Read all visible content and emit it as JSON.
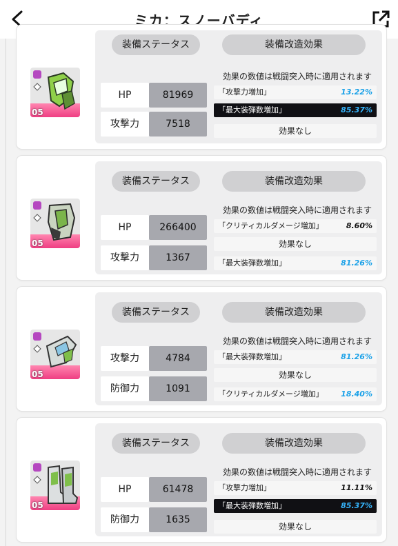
{
  "header": {
    "title": "ミカ：スノーバディ"
  },
  "labels": {
    "status": "装備ステータス",
    "modify": "装備改造効果",
    "note": "効果の数値は戦闘突入時に適用されます"
  },
  "colors": {
    "accent_blue": "#1aa1e8",
    "pink": "#ef3e82"
  },
  "cards": [
    {
      "grade": "05",
      "icon": "gloves-icon",
      "stats": [
        {
          "label": "HP",
          "value": "81969"
        },
        {
          "label": "攻撃力",
          "value": "7518"
        }
      ],
      "effects": [
        {
          "name": "「攻撃力増加」",
          "value": "13.22%",
          "style": "normal"
        },
        {
          "name": "「最大装弾数増加」",
          "value": "85.37%",
          "style": "dark"
        },
        {
          "name": "効果なし",
          "value": "",
          "style": "none"
        }
      ]
    },
    {
      "grade": "05",
      "icon": "armor-icon",
      "stats": [
        {
          "label": "HP",
          "value": "266400"
        },
        {
          "label": "攻撃力",
          "value": "1367"
        }
      ],
      "effects": [
        {
          "name": "「クリティカルダメージ増加」",
          "value": "8.60%",
          "style": "normal-black"
        },
        {
          "name": "効果なし",
          "value": "",
          "style": "none"
        },
        {
          "name": "「最大装弾数増加」",
          "value": "81.26%",
          "style": "normal"
        }
      ]
    },
    {
      "grade": "05",
      "icon": "gauntlet-icon",
      "stats": [
        {
          "label": "攻撃力",
          "value": "4784"
        },
        {
          "label": "防御力",
          "value": "1091"
        }
      ],
      "effects": [
        {
          "name": "「最大装弾数増加」",
          "value": "81.26%",
          "style": "normal"
        },
        {
          "name": "効果なし",
          "value": "",
          "style": "none"
        },
        {
          "name": "「クリティカルダメージ増加」",
          "value": "18.40%",
          "style": "normal"
        }
      ]
    },
    {
      "grade": "05",
      "icon": "boots-icon",
      "stats": [
        {
          "label": "HP",
          "value": "61478"
        },
        {
          "label": "防御力",
          "value": "1635"
        }
      ],
      "effects": [
        {
          "name": "「攻撃力増加」",
          "value": "11.11%",
          "style": "normal-black"
        },
        {
          "name": "「最大装弾数増加」",
          "value": "85.37%",
          "style": "dark"
        },
        {
          "name": "効果なし",
          "value": "",
          "style": "none"
        }
      ]
    }
  ]
}
